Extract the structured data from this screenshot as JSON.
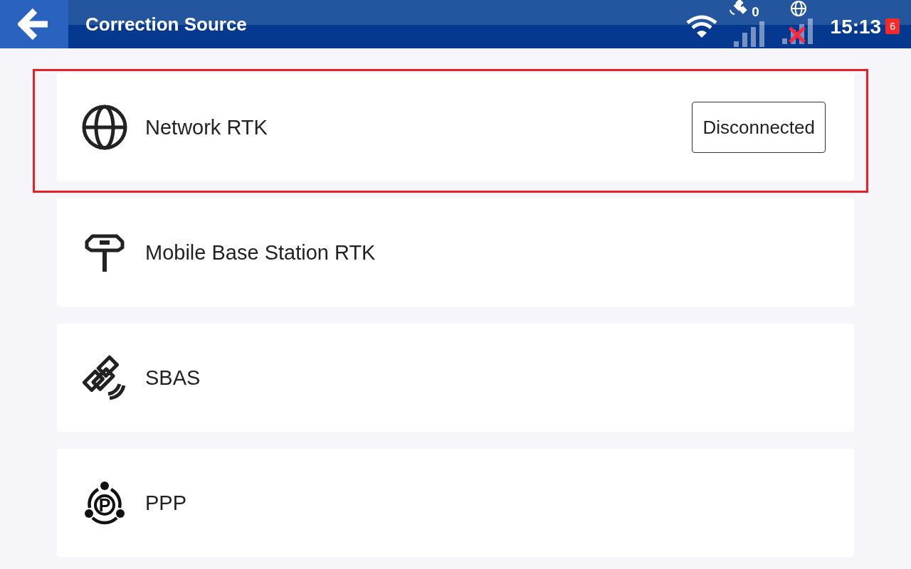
{
  "header": {
    "title": "Correction Source"
  },
  "status_bar": {
    "satellite_count": "0",
    "network_connected": false,
    "time": "15:13",
    "notification_count": "6"
  },
  "items": [
    {
      "kind": "globe",
      "label": "Network RTK",
      "status": "Disconnected",
      "highlighted": true
    },
    {
      "kind": "antenna",
      "label": "Mobile Base Station RTK",
      "highlighted": false
    },
    {
      "kind": "satellite",
      "label": "SBAS",
      "highlighted": false
    },
    {
      "kind": "ppp",
      "label": "PPP",
      "icon_text": "P",
      "highlighted": false
    }
  ]
}
